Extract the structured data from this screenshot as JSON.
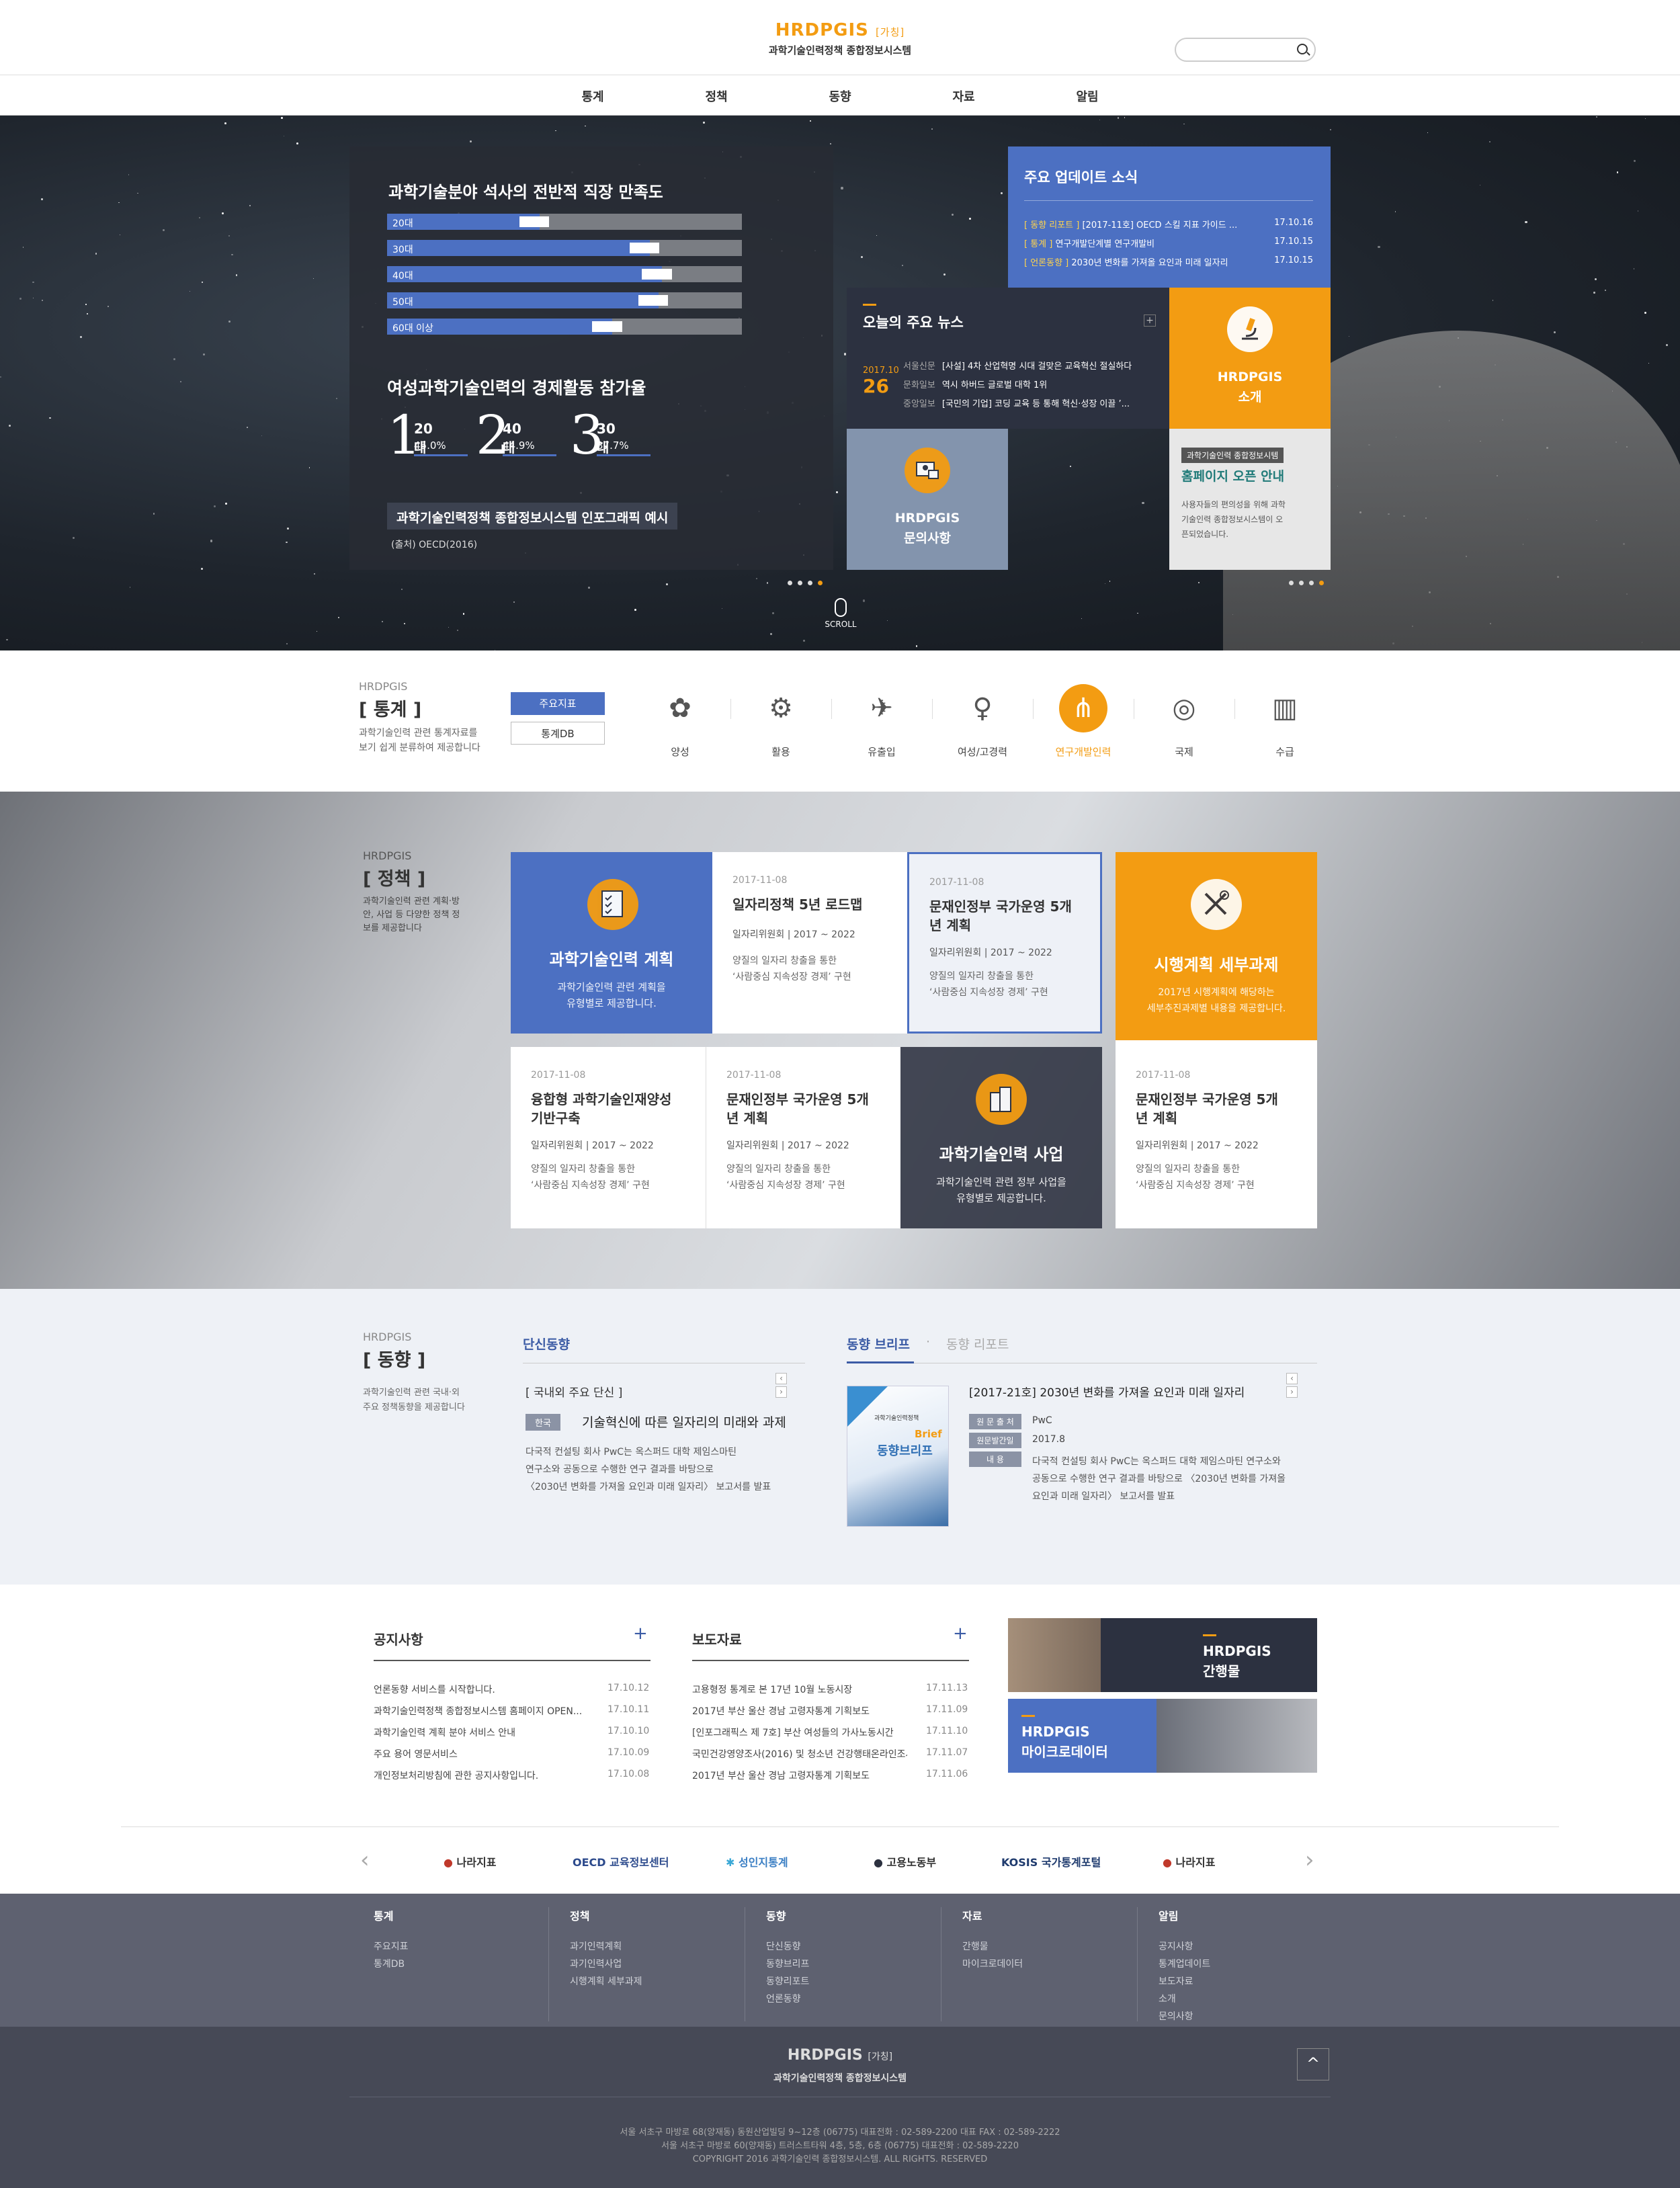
{
  "header": {
    "logo_main": "HRDPGIS",
    "logo_tag": "[가칭]",
    "logo_sub": "과학기술인력정책 종합정보시스템",
    "search_placeholder": ""
  },
  "gnb": [
    "통계",
    "정책",
    "동향",
    "자료",
    "알림"
  ],
  "hero": {
    "satisfaction_title": "과학기술분야 석사의 전반적 직장 만족도",
    "bars": [
      {
        "label": "20대",
        "value": "42.9%",
        "pct": 42.9
      },
      {
        "label": "30대",
        "value": "74.0%",
        "pct": 74.0
      },
      {
        "label": "40대",
        "value": "77.5%",
        "pct": 77.5
      },
      {
        "label": "50대",
        "value": "76.5%",
        "pct": 76.5
      },
      {
        "label": "60대 이상",
        "value": "63.5%",
        "pct": 63.5
      }
    ],
    "women_title": "여성과학기술인력의 경제활동 참가율",
    "ranks": [
      {
        "num": "1",
        "age": "20대",
        "val": "45.0%"
      },
      {
        "num": "2",
        "age": "40대",
        "val": "44.9%"
      },
      {
        "num": "3",
        "age": "30대",
        "val": "37.7%"
      }
    ],
    "caption": "과학기술인력정책 종합정보시스템 인포그래픽 예시",
    "source": "(출처) OECD(2016)",
    "scroll": "SCROLL"
  },
  "updates": {
    "title": "주요 업데이트 소식",
    "items": [
      {
        "tag": "[ 동향 리포트 ]",
        "text": " [2017-11호] OECD 스킬 지표 가이드 ...",
        "date": "17.10.16"
      },
      {
        "tag": "[ 통계 ]",
        "text": " 연구개발단계별 연구개발비",
        "date": "17.10.15"
      },
      {
        "tag": "[ 언론동향 ]",
        "text": " 2030년 변화를 가져올 요인과 미래 일자리",
        "date": "17.10.15"
      }
    ]
  },
  "news": {
    "title": "오늘의 주요 뉴스",
    "plus": "+",
    "date_ym": "2017.10",
    "date_d": "26",
    "items": [
      {
        "pub": "서울신문",
        "text": "[사설] 4차 산업혁명 시대 걸맞은 교육혁신 절실하다"
      },
      {
        "pub": "문화일보",
        "text": "역시 하버드 글로벌 대학 1위"
      },
      {
        "pub": "중앙일보",
        "text": "[국민의 기업] 코딩 교육 등 통해 혁신·성장 이끌 ’..."
      }
    ]
  },
  "tiles": {
    "intro": "HRDPGIS\n소개",
    "intro_l1": "HRDPGIS",
    "intro_l2": "소개",
    "inquiry_l1": "HRDPGIS",
    "inquiry_l2": "문의사항",
    "notice_badge": "과학기술인력 종합정보시템",
    "notice_title": "홈페이지 오픈 안내",
    "notice_desc": "사용자들의 편의성을 위해 과학기술인력 종합정보시스템이 오픈되었습니다."
  },
  "stats": {
    "brand": "HRDPGIS",
    "title": "[ 통계 ]",
    "desc1": "과학기술인력 관련 통계자료를",
    "desc2": "보기 쉽게 분류하여 제공합니다",
    "btn_main": "주요지표",
    "btn_db": "통계DB",
    "categories": [
      "양성",
      "활용",
      "유출입",
      "여성/고경력",
      "연구개발인력",
      "국제",
      "수급"
    ]
  },
  "policy": {
    "brand": "HRDPGIS",
    "title": "[ 정책 ]",
    "desc": "과학기술인력 관련 계획·방안, 사업 등 다양한 정책 정보를 제공합니다",
    "plan_title": "과학기술인력 계획",
    "plan_desc1": "과학기술인력 관련 계획을",
    "plan_desc2": "유형별로 제공합니다.",
    "exec_title": "시행계획 세부과제",
    "exec_desc1": "2017년 시행계획에 해당하는",
    "exec_desc2": "세부추진과제별 내용을 제공합니다.",
    "biz_title": "과학기술인력 사업",
    "biz_desc1": "과학기술인력 관련 정부 사업을",
    "biz_desc2": "유형별로 제공합니다.",
    "cards": [
      {
        "date": "2017-11-08",
        "title": "일자리정책 5년 로드맵",
        "org": "일자리위원회 | 2017 ~ 2022",
        "text1": "양질의 일자리 창출을 통한",
        "text2": "‘사람중심 지속성장 경제’ 구현"
      },
      {
        "date": "2017-11-08",
        "title": "문재인정부 국가운영 5개년 계획",
        "org": "일자리위원회 | 2017 ~ 2022",
        "text1": "양질의 일자리 창출을 통한",
        "text2": "‘사람중심 지속성장 경제’ 구현"
      },
      {
        "date": "2017-11-08",
        "title": "융합형 과학기술인재양성 기반구축",
        "org": "일자리위원회 | 2017 ~ 2022",
        "text1": "양질의 일자리 창출을 통한",
        "text2": "‘사람중심 지속성장 경제’ 구현"
      },
      {
        "date": "2017-11-08",
        "title": "문재인정부 국가운영 5개년 계획",
        "org": "일자리위원회 | 2017 ~ 2022",
        "text1": "양질의 일자리 창출을 통한",
        "text2": "‘사람중심 지속성장 경제’ 구현"
      },
      {
        "date": "2017-11-08",
        "title": "문재인정부 국가운영 5개년 계획",
        "org": "일자리위원회 | 2017 ~ 2022",
        "text1": "양질의 일자리 창출을 통한",
        "text2": "‘사람중심 지속성장 경제’ 구현"
      }
    ]
  },
  "trends": {
    "brand": "HRDPGIS",
    "title": "[ 동향 ]",
    "desc1": "과학기술인력 관련 국내·외",
    "desc2": "주요 정책동향을 제공합니다",
    "brief_tab": "단신동향",
    "brief_head": "[ 국내외 주요 단신 ]",
    "brief_badge": "한국",
    "brief_title": "기술혁신에 따른 일자리의 미래와 과제",
    "brief_text1": "다국적 컨설팅 회사 PwC는 옥스퍼드 대학 제임스마틴",
    "brief_text2": "연구소와 공동으로 수행한 연구 결과를 바탕으로",
    "brief_text3": "〈2030년 변화를 가져올 요인과 미래 일자리〉 보고서를 발표",
    "tab_a": "동향 브리프",
    "tab_sep": "·",
    "tab_b": "동향 리포트",
    "report_title": "[2017-21호] 2030년 변화를 가져올 요인과 미래 일자리",
    "cover_small": "과학기술인력정책",
    "cover_brief": "Brief",
    "cover_title": "동향브리프",
    "labels": [
      "원 문 출 처",
      "원문발간일",
      "내      용"
    ],
    "source_val": "PwC",
    "date_val": "2017.8",
    "content1": "다국적 컨설팅 회사 PwC는 옥스퍼드 대학 제임스마틴 연구소와",
    "content2": "공동으로 수행한 연구 결과를 바탕으로 〈2030년 변화를 가져올",
    "content3": "요인과 미래 일자리〉 보고서를 발표"
  },
  "boards": {
    "notice_title": "공지사항",
    "press_title": "보도자료",
    "plus": "+",
    "notices": [
      {
        "t": "언론동향 서비스를 시작합니다.",
        "d": "17.10.12"
      },
      {
        "t": "과학기술인력정책 종합정보시스템 홈페이지 OPEN...",
        "d": "17.10.11"
      },
      {
        "t": "과학기술인력 계획 분야 서비스 안내",
        "d": "17.10.10"
      },
      {
        "t": "주요 용어 영문서비스",
        "d": "17.10.09"
      },
      {
        "t": "개인정보처리방침에 관한 공지사항입니다.",
        "d": "17.10.08"
      }
    ],
    "press": [
      {
        "t": "고용형정 통계로 본 17년 10월 노동시장",
        "d": "17.11.13"
      },
      {
        "t": "2017년 부산 울산 경남 고령자통계 기획보도",
        "d": "17.11.09"
      },
      {
        "t": "[인포그래픽스 제 7호] 부산 여성들의 가사노동시간",
        "d": "17.11.10"
      },
      {
        "t": "국민건강영양조사(2016) 및 청소년 건강행태온라인조사...",
        "d": "17.11.07"
      },
      {
        "t": "2017년 부산 울산 경남 고령자통계 기획보도",
        "d": "17.11.06"
      }
    ],
    "banner1_l1": "HRDPGIS",
    "banner1_l2": "간행물",
    "banner2_l1": "HRDPGIS",
    "banner2_l2": "마이크로데이터"
  },
  "partners": [
    "나라지표",
    "OECD 교육정보센터",
    "성인지통계",
    "고용노동부",
    "KOSIS 국가통계포털",
    "나라지표"
  ],
  "sitemap": [
    {
      "h": "통계",
      "items": [
        "주요지표",
        "통계DB"
      ]
    },
    {
      "h": "정책",
      "items": [
        "과기인력계획",
        "과기인력사업",
        "시행계획 세부과제"
      ]
    },
    {
      "h": "동향",
      "items": [
        "단신동향",
        "동향브리프",
        "동향리포트",
        "언론동향"
      ]
    },
    {
      "h": "자료",
      "items": [
        "간행물",
        "마이크로데이터"
      ]
    },
    {
      "h": "알림",
      "items": [
        "공지사항",
        "통계업데이트",
        "보도자료",
        "소개",
        "문의사항"
      ]
    }
  ],
  "footer": {
    "logo": "HRDPGIS",
    "tag": "[가칭]",
    "sub": "과학기술인력정책 종합정보시스템",
    "addr1": "서울 서초구 마방로 68(양재동) 동원산업빌딩 9~12층 (06775) 대표전화 : 02-589-2200 대표 FAX : 02-589-2222",
    "addr2": "서울 서초구 마방로 60(양재동) 트러스트타워 4층, 5층, 6층 (06775) 대표전화 : 02-589-2220",
    "copy": "COPYRIGHT 2016 과학기술인력 종합정보시스템. ALL RIGHTS. RESERVED",
    "top": "^"
  },
  "colors": {
    "accent_blue": "#4c70c2",
    "accent_orange": "#f39c12",
    "dark_navy": "#2c3140"
  }
}
